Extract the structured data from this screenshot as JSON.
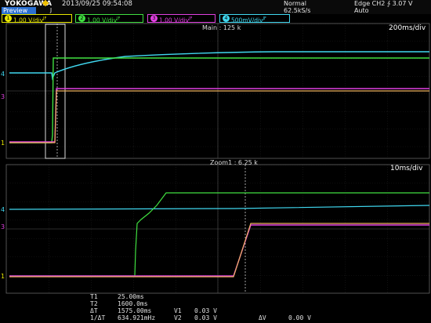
{
  "header": {
    "brand": "YOKOGAWA",
    "datetime": "2013/09/25 09:54:08",
    "mode_line1": "Normal",
    "mode_line2": "62.5kS/s",
    "trigger_line1": "Edge CH2 ∱ 3.07 V",
    "trigger_line2": "Auto",
    "preview_label": "Preview",
    "preview_marker": "J"
  },
  "channels": [
    {
      "num": "1",
      "label": "1.00 V/div",
      "suffix": "JF",
      "color": "#e8e800"
    },
    {
      "num": "2",
      "label": "1.00 V/div",
      "suffix": "JF",
      "color": "#40e040"
    },
    {
      "num": "3",
      "label": "1.00 V/div",
      "suffix": "JF",
      "color": "#e040e0"
    },
    {
      "num": "4",
      "label": "500mV/div",
      "suffix": "JF",
      "color": "#40d8f0"
    }
  ],
  "main_panel": {
    "title": "Main : 125 k",
    "timebase": "200ms/div"
  },
  "zoom_panel": {
    "title": "Zoom1 : 6.25 k",
    "timebase": "10ms/div"
  },
  "measurements": {
    "t1_label": "T1",
    "t1_value": "25.00ms",
    "t2_label": "T2",
    "t2_value": "1600.0ms",
    "dt_label": "ΔT",
    "dt_value": "1575.00ms",
    "inv_dt_label": "1/ΔT",
    "inv_dt_value": "634.921mHz",
    "v1_label": "V1",
    "v1_value": "0.03 V",
    "v2_label": "V2",
    "v2_value": "0.03 V",
    "dv_label": "ΔV",
    "dv_value": "0.00 V"
  },
  "ground_markers": {
    "ch4": "4",
    "ch3": "3",
    "ch1": "1"
  },
  "colors": {
    "ch1": "#e8e800",
    "ch2": "#40e040",
    "ch3": "#e040e0",
    "ch4": "#40d8f0",
    "grid": "#3a3a3a",
    "ch1_orange": "#f0b060"
  }
}
